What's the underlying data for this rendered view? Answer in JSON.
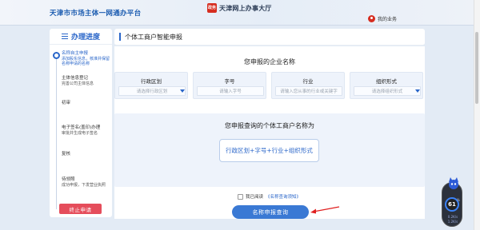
{
  "header": {
    "site_title": "天津市市场主体一网通办平台",
    "seal_text": "政务",
    "brand": "天津网上办事大厅",
    "user_center": "我的业务"
  },
  "sidebar": {
    "title": "办理进度",
    "steps": [
      {
        "title": "名称自主申报",
        "desc": "添加股东信息，核准并保留名称申请的名称",
        "active": true
      },
      {
        "title": "主体信息登记",
        "desc": "完善公司主体信息",
        "active": false
      },
      {
        "title": "初审",
        "desc": "",
        "active": false
      },
      {
        "title": "电子签名(盖印)办理",
        "desc": "审批并生成电子签名",
        "active": false
      },
      {
        "title": "复核",
        "desc": "",
        "active": false
      },
      {
        "title": "待领照",
        "desc": "成功申报，下发营业执照",
        "active": false
      }
    ],
    "stop_button": "终止申请"
  },
  "main": {
    "page_title": "个体工商户智能申报",
    "section_title": "您申报的企业名称",
    "fields": [
      {
        "label": "行政区划",
        "placeholder": "请选择行政区划",
        "dropdown": true
      },
      {
        "label": "字号",
        "placeholder": "请输入字号",
        "dropdown": false
      },
      {
        "label": "行业",
        "placeholder": "请输入您从事的行业或关键字",
        "dropdown": false
      },
      {
        "label": "组织形式",
        "placeholder": "请选择组织形式",
        "dropdown": true
      }
    ],
    "result_title": "您申报查询的个体工商户名称为",
    "formula": "行政区划+字号+行业+组织形式",
    "agree_prefix": "我已阅读",
    "agree_link": "《名称查询须知》",
    "query_button": "名称申报查询"
  },
  "widget": {
    "score": "61",
    "unit": "%",
    "up_speed": "0.2K/s",
    "down_speed": "1.2K/s"
  },
  "colors": {
    "accent": "#2a66c9",
    "danger": "#e54d5b",
    "arrow": "#e02020",
    "page_bg": "#e3ebf5"
  }
}
